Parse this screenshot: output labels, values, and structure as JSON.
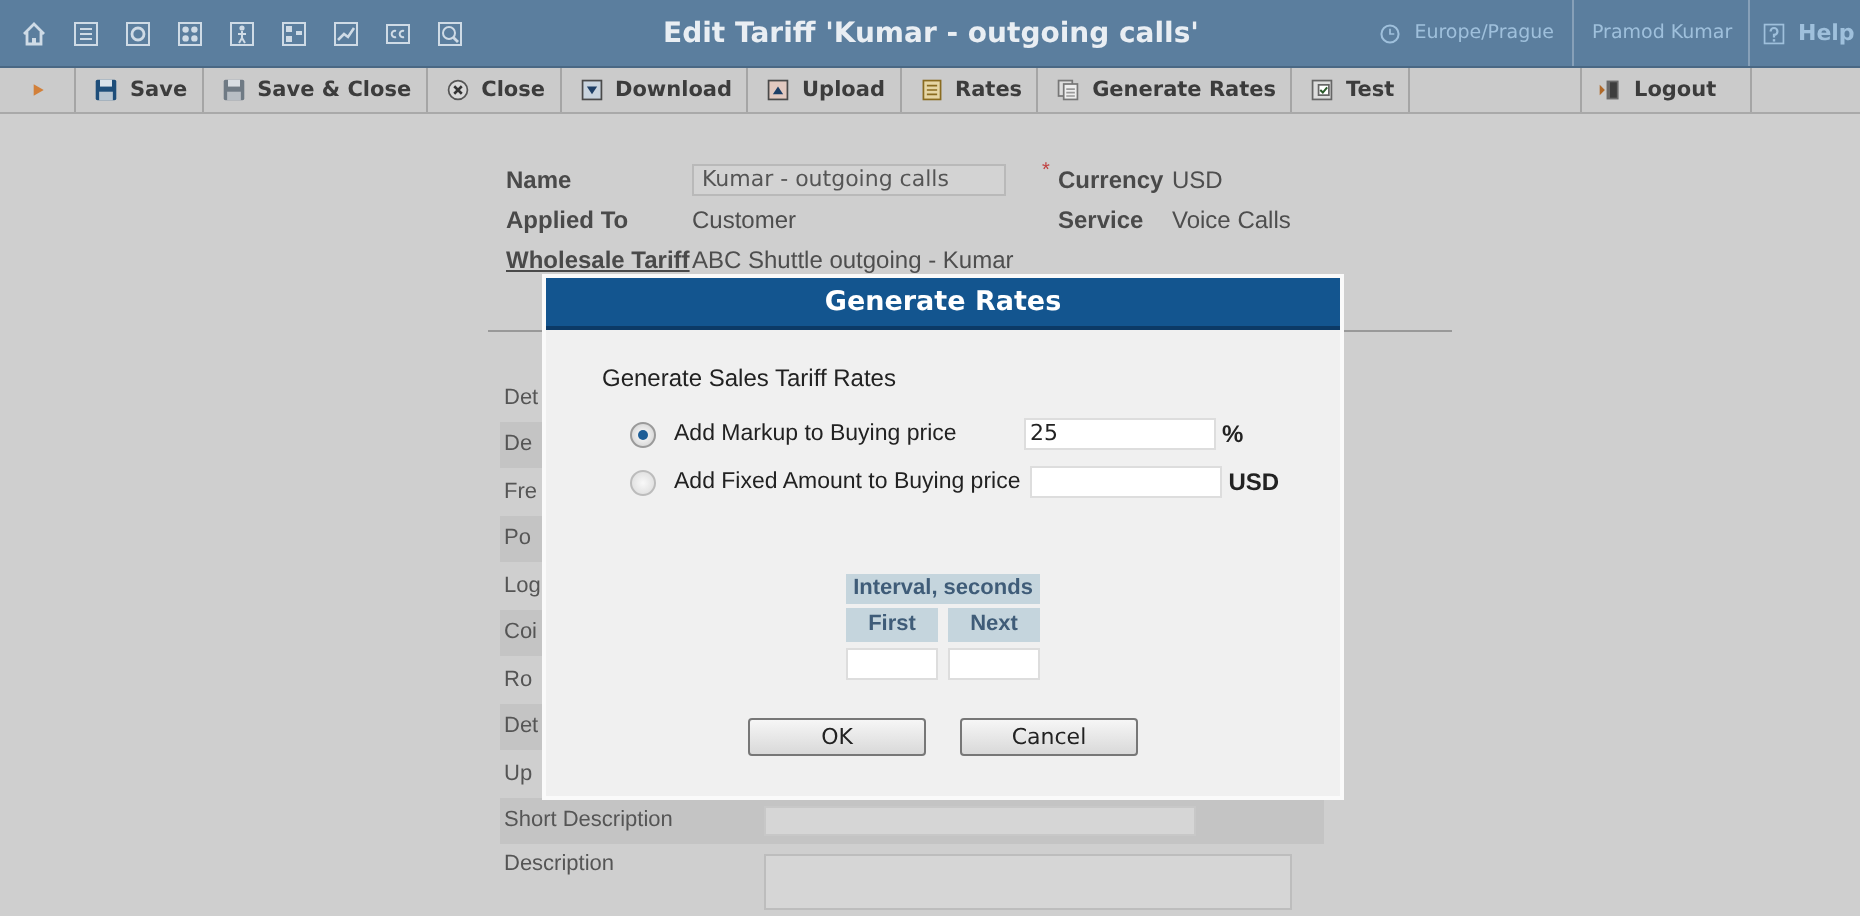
{
  "window": {
    "title": "Edit Tariff 'Kumar - outgoing calls'"
  },
  "top_bar": {
    "timezone": "Europe/Prague",
    "user": "Pramod Kumar",
    "help": "Help"
  },
  "toolbar": {
    "buttons": [
      {
        "label": "Save"
      },
      {
        "label": "Save & Close"
      },
      {
        "label": "Close"
      },
      {
        "label": "Download"
      },
      {
        "label": "Upload"
      },
      {
        "label": "Rates"
      },
      {
        "label": "Generate Rates"
      },
      {
        "label": "Test"
      }
    ],
    "logout": "Logout"
  },
  "form": {
    "header": [
      {
        "label": "Name",
        "value": "Kumar - outgoing calls",
        "kind": "input",
        "required_mark": "*",
        "side_label": "Currency",
        "side_value": "USD"
      },
      {
        "label": "Applied To",
        "value": "Customer",
        "kind": "text",
        "side_label": "Service",
        "side_value": "Voice Calls"
      },
      {
        "label": "Wholesale Tariff",
        "value": "ABC Shuttle outgoing - Kumar",
        "kind": "link"
      }
    ],
    "rows": [
      {
        "label": "Det",
        "kind": "text"
      },
      {
        "label": "De",
        "kind": "text"
      },
      {
        "label": "Fre",
        "kind": "text"
      },
      {
        "label": "Po",
        "kind": "text"
      },
      {
        "label": "Log",
        "kind": "text"
      },
      {
        "label": "Coi",
        "kind": "text"
      },
      {
        "label": "Ro",
        "kind": "text"
      },
      {
        "label": "Det",
        "kind": "text"
      },
      {
        "label": "Up",
        "kind": "text"
      },
      {
        "label": "Short Description",
        "kind": "input"
      },
      {
        "label": "Description",
        "kind": "textarea"
      }
    ]
  },
  "dialog": {
    "title": "Generate Rates",
    "heading": "Generate Sales Tariff Rates",
    "options": [
      {
        "label": "Add Markup to Buying price",
        "selected": true,
        "value": "25",
        "unit": "%"
      },
      {
        "label": "Add Fixed Amount to Buying price",
        "selected": false,
        "unit": "USD"
      }
    ],
    "interval": {
      "title": "Interval, seconds",
      "columns": [
        "First",
        "Next"
      ]
    },
    "buttons": [
      "OK",
      "Cancel"
    ]
  }
}
